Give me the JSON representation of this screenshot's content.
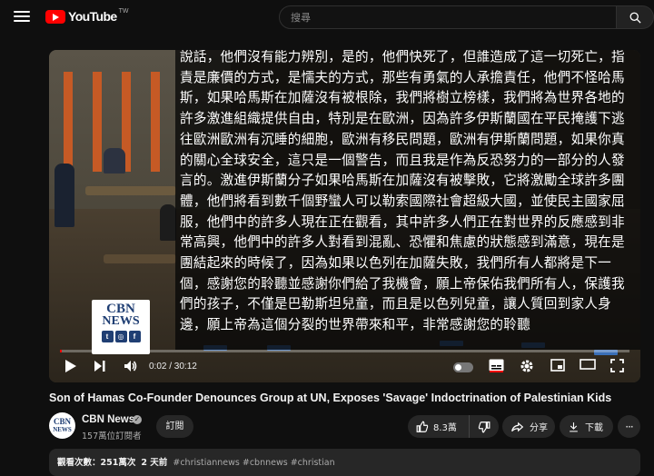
{
  "header": {
    "logo_text": "YouTube",
    "logo_region": "TW",
    "search_placeholder": "搜尋",
    "icons": [
      "menu-icon",
      "search-icon"
    ]
  },
  "player": {
    "caption": "說話，他們沒有能力辨別，是的，他們快死了，但誰造成了這一切死亡，指責是廉價的方式，是懦夫的方式，那些有勇氣的人承擔責任，他們不怪哈馬斯，如果哈馬斯在加薩沒有被根除，我們將樹立榜樣，我們將為世界各地的許多激進組織提供自由，特別是在歐洲，因為許多伊斯蘭國在平民掩護下逃往歐洲歐洲有沉睡的細胞，歐洲有移民問題，歐洲有伊斯蘭問題，如果你真的關心全球安全，這只是一個警告，而且我是作為反恐努力的一部分的人發言的。激進伊斯蘭分子如果哈馬斯在加薩沒有被擊敗，它將激勵全球許多團體，他們將看到數千個野蠻人可以勒索國際社會超級大國，並使民主國家屈服，他們中的許多人現在正在觀看，其中許多人們正在對世界的反應感到非常高興，他們中的許多人對看到混亂、恐懼和焦慮的狀態感到滿意，現在是團結起來的時候了，因為如果以色列在加薩失敗，我們所有人都將是下一個，感謝您的聆聽並感謝你們給了我機會，願上帝保佑我們所有人，保護我們的孩子，不僅是巴勒斯坦兒童，而且是以色列兒童，讓人質回到家人身邊，願上帝為這個分裂的世界帶來和平，非常感謝您的聆聽",
    "watermark_top": "CBN",
    "watermark_bottom": "NEWS",
    "current_time": "0:02",
    "duration": "30:12",
    "time_display": "0:02 / 30:12",
    "progress_fraction": 0.0011,
    "accent_color": "#ff0000"
  },
  "video": {
    "title": "Son of Hamas Co-Founder Denounces Group at UN, Exposes 'Savage' Indoctrination of Palestinian Kids",
    "channel_name": "CBN News",
    "subscribers": "157萬位訂閱者",
    "subscribe_label": "訂閱",
    "likes": "8.3萬",
    "share_label": "分享",
    "download_label": "下載",
    "views_label": "觀看次數：251萬次",
    "age": "2 天前",
    "hashtags": "#christiannews #cbnnews #christian"
  }
}
